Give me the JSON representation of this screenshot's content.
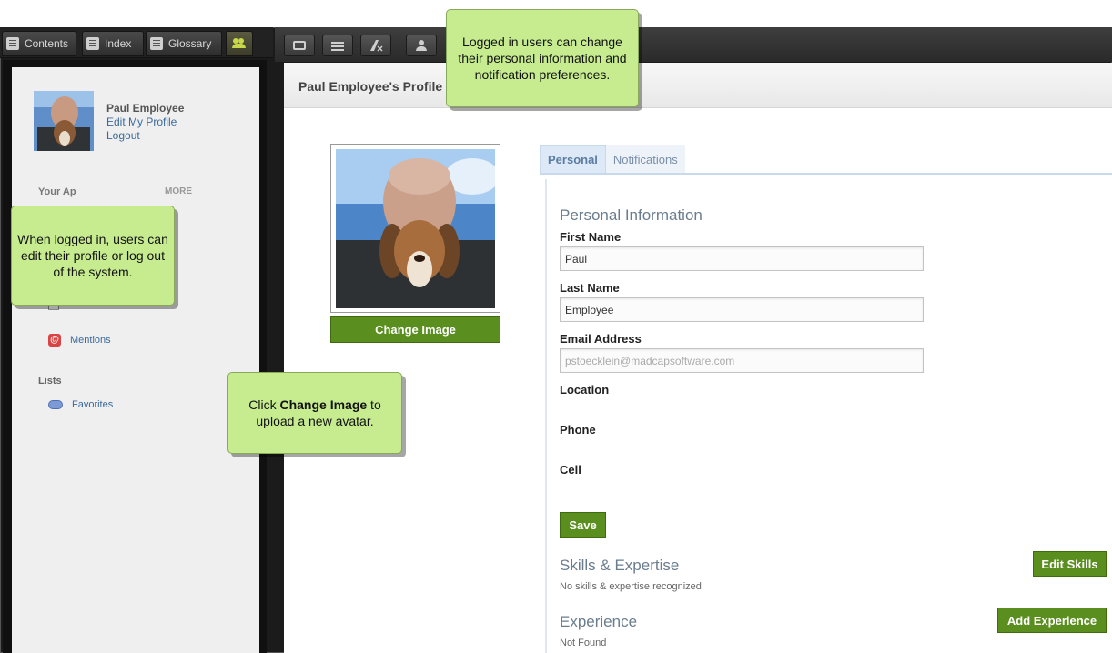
{
  "nav_tabs": {
    "contents": "Contents",
    "index": "Index",
    "glossary": "Glossary"
  },
  "sidebar": {
    "user_name": "Paul Employee",
    "edit_profile": "Edit My Profile",
    "logout": "Logout",
    "apps_heading_visible": "Your Ap",
    "more": "MORE",
    "items": [
      {
        "label": "Tasks",
        "icon": "tasks-icon"
      },
      {
        "label": "Mentions",
        "icon": "mentions-icon"
      }
    ],
    "lists_heading": "Lists",
    "list_items": [
      {
        "label": "Favorites",
        "icon": "favorites-icon"
      }
    ]
  },
  "main": {
    "page_title": "Paul Employee's Profile",
    "change_image": "Change Image",
    "tabs": [
      {
        "label": "Personal",
        "active": true
      },
      {
        "label": "Notifications",
        "active": false
      }
    ],
    "personal_heading": "Personal Information",
    "fields": {
      "first_name_label": "First Name",
      "first_name_value": "Paul",
      "last_name_label": "Last Name",
      "last_name_value": "Employee",
      "email_label": "Email Address",
      "email_value": "pstoecklein@madcapsoftware.com",
      "location_label": "Location",
      "phone_label": "Phone",
      "cell_label": "Cell"
    },
    "save": "Save",
    "skills_heading": "Skills & Expertise",
    "skills_text": "No skills & expertise recognized",
    "edit_skills": "Edit Skills",
    "experience_heading": "Experience",
    "experience_text": "Not Found",
    "add_experience": "Add Experience"
  },
  "callouts": {
    "top": "Logged in users can change their personal information and notification preferences.",
    "left": "When logged in, users can edit their profile or log out of the system.",
    "bottom_prefix": "Click ",
    "bottom_bold": "Change Image",
    "bottom_suffix": " to upload a new avatar."
  },
  "colors": {
    "accent_green": "#5a8e1e",
    "callout_green": "#c7ec8f",
    "link_blue": "#3a6a9c",
    "tab_active_bg": "#dde9f6"
  }
}
